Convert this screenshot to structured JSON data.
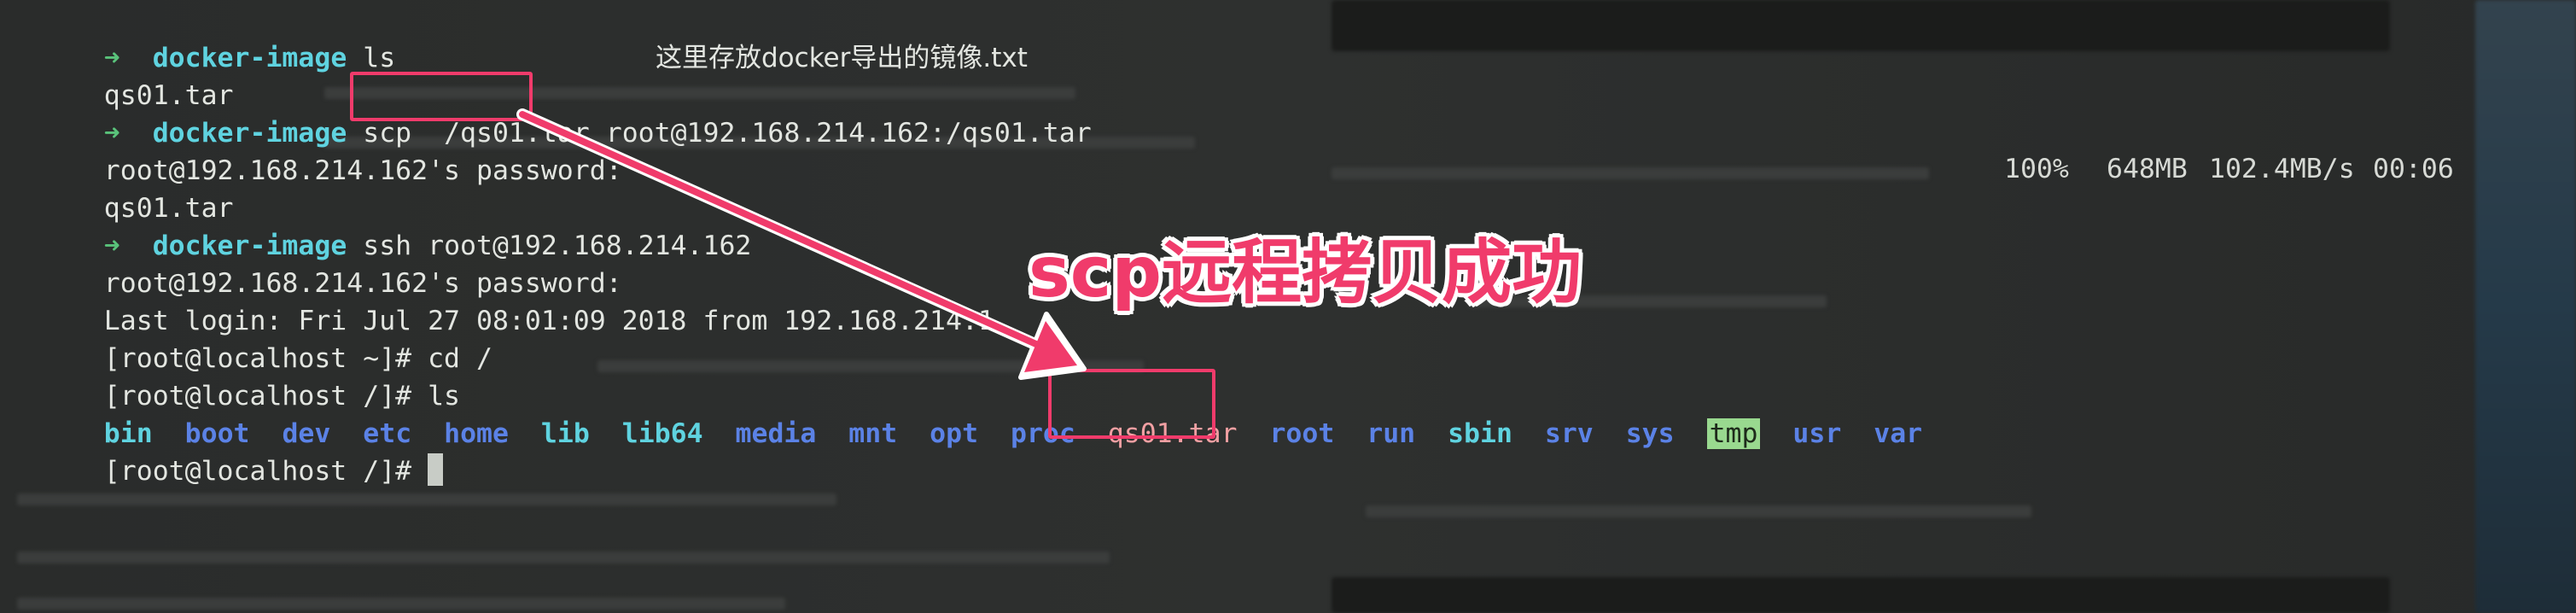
{
  "terminal": {
    "prompt_arrow": "➜",
    "prompt_dir": "docker-image",
    "lines": {
      "l1_cmd": "ls",
      "l2_output": "qs01.tar",
      "l2_note": "这里存放docker导出的镜像.txt",
      "l3_cmd_prefix": "scp ",
      "l3_file": "/qs01.tar",
      "l3_cmd_suffix": " root@192.168.214.162:/qs01.tar",
      "l4_output": "root@192.168.214.162's password:",
      "l5_output": "qs01.tar",
      "l6_cmd": "ssh root@192.168.214.162",
      "l7_output": "root@192.168.214.162's password:",
      "l8_output": "Last login: Fri Jul 27 08:01:09 2018 from 192.168.214.1",
      "l9_output": "[root@localhost ~]# cd /",
      "l10_output": "[root@localhost /]# ls",
      "l12_prompt": "[root@localhost /]# "
    },
    "ls_items": [
      "bin",
      "boot",
      "dev",
      "etc",
      "home",
      "lib",
      "lib64",
      "media",
      "mnt",
      "opt",
      "proc",
      "qs01.tar",
      "root",
      "run",
      "sbin",
      "srv",
      "sys",
      "tmp",
      "usr",
      "var"
    ],
    "progress": {
      "percent": "100%",
      "size": "648MB",
      "speed": "102.4MB/s",
      "time": "00:06"
    }
  },
  "callout_text": "scp远程拷贝成功",
  "colors": {
    "annotation": "#f03b6b",
    "prompt_arrow": "#59c27a",
    "prompt_dir": "#5fd3e0",
    "ls_dir": "#5b82e6",
    "ls_file": "#f2a0a3",
    "ls_tmp_bg": "#99d98f"
  }
}
